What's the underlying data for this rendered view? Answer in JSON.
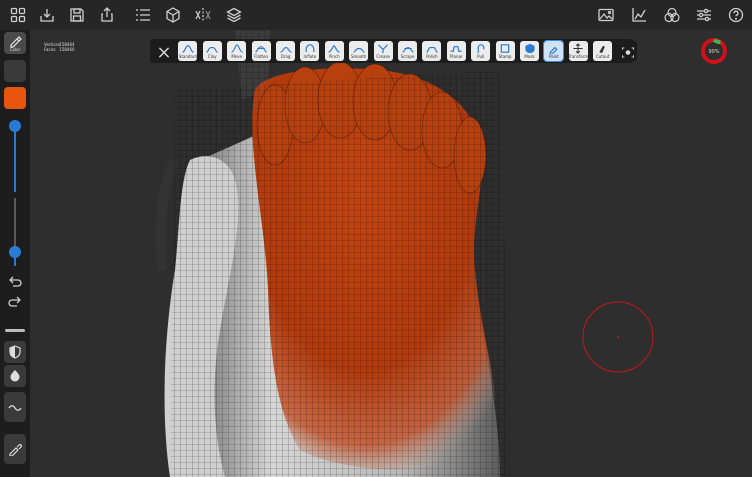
{
  "stats": {
    "vertices_label": "Vertices:",
    "vertices_value": "158464",
    "faces_label": "Faces:",
    "faces_value": "158460"
  },
  "left_panel": {
    "brush_label": "Color",
    "color_swatch": "#e8550f",
    "accent": "#2a7bd4",
    "sliders": [
      {
        "name": "radius",
        "value": 0.95
      },
      {
        "name": "intensity",
        "value": 0.2
      }
    ]
  },
  "tools": [
    {
      "label": "",
      "icon": "x-icon"
    },
    {
      "label": "Standard",
      "icon": "standard-icon"
    },
    {
      "label": "Clay",
      "icon": "clay-icon"
    },
    {
      "label": "Move",
      "icon": "move-icon"
    },
    {
      "label": "Flatten",
      "icon": "flatten-icon"
    },
    {
      "label": "Drag",
      "icon": "drag-icon"
    },
    {
      "label": "Inflate",
      "icon": "inflate-icon"
    },
    {
      "label": "Pinch",
      "icon": "pinch-icon"
    },
    {
      "label": "Smooth",
      "icon": "smooth-icon"
    },
    {
      "label": "Crease",
      "icon": "crease-icon"
    },
    {
      "label": "Scrape",
      "icon": "scrape-icon"
    },
    {
      "label": "Polish",
      "icon": "polish-icon"
    },
    {
      "label": "Planar",
      "icon": "planar-icon"
    },
    {
      "label": "Pull",
      "icon": "pull-icon"
    },
    {
      "label": "Stamp",
      "icon": "stamp-icon"
    },
    {
      "label": "Mask",
      "icon": "mask-icon"
    },
    {
      "label": "Paint",
      "icon": "paint-icon"
    },
    {
      "label": "Transform",
      "icon": "transform-icon"
    },
    {
      "label": "Cutout",
      "icon": "cutout-icon"
    }
  ],
  "gauge": {
    "value_label": "90%",
    "value": 0.9,
    "ring_color": "#d0101a",
    "fill_color": "#3cb54a"
  }
}
